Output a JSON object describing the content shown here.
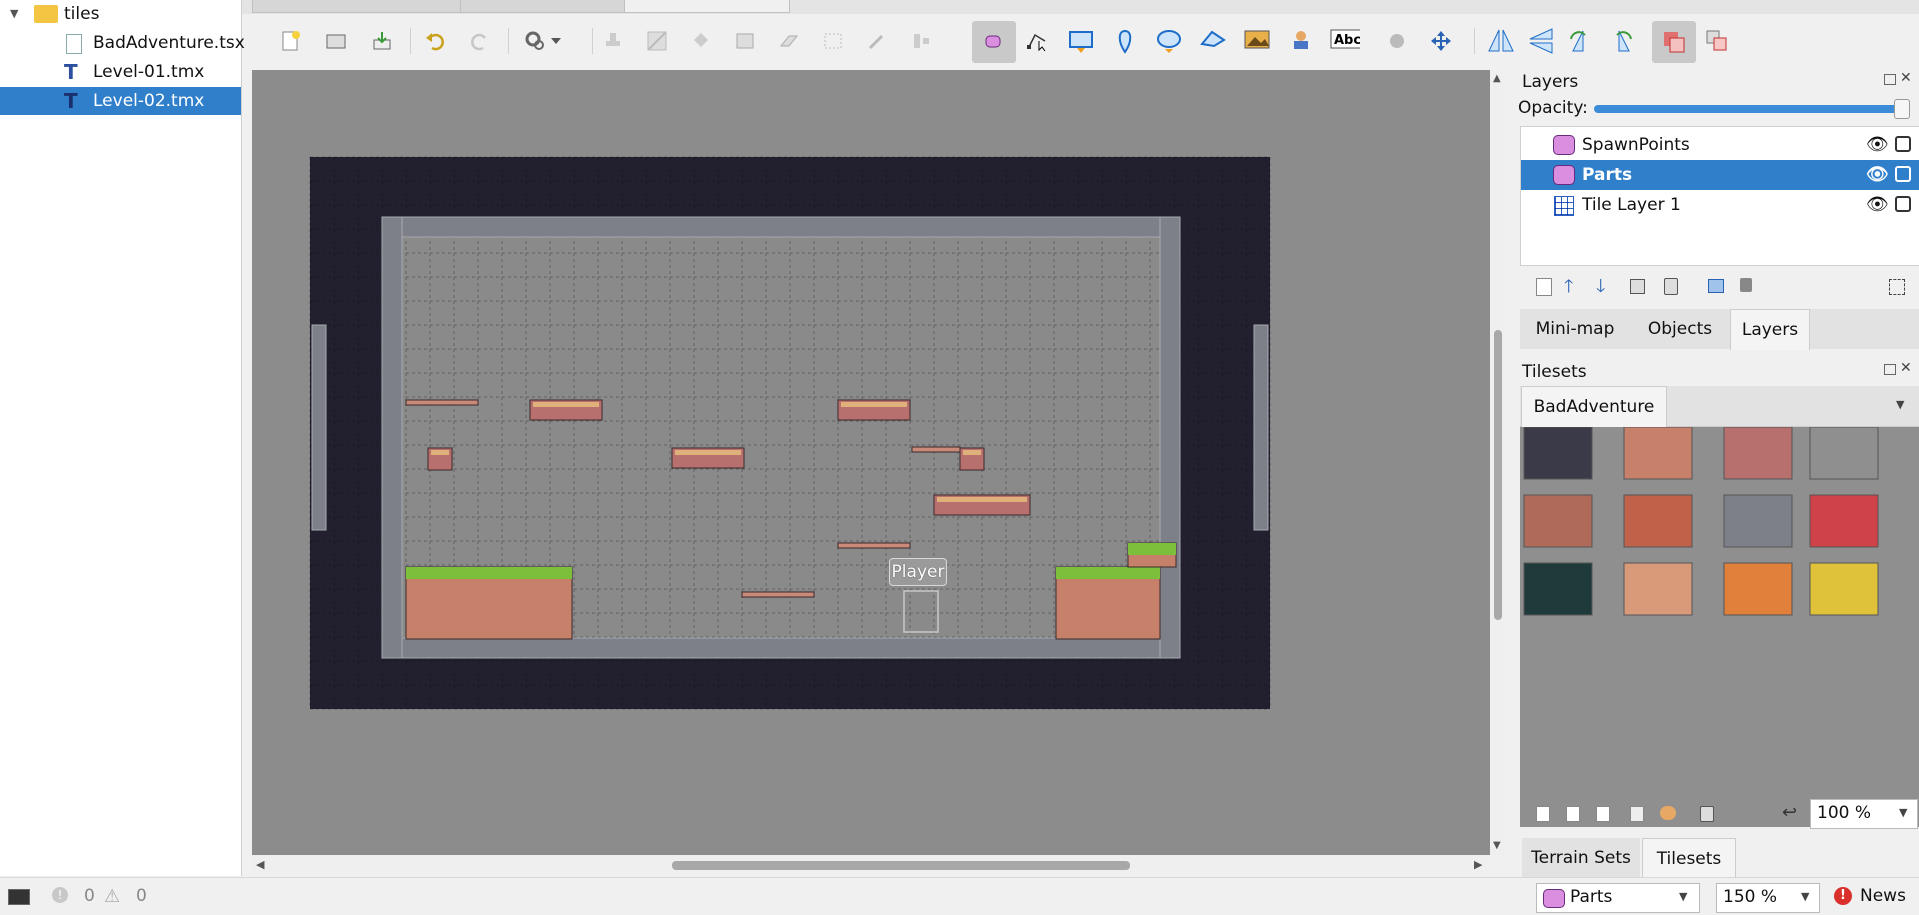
{
  "project": {
    "folder": "tiles",
    "files": [
      "BadAdventure.tsx",
      "Level-01.tmx",
      "Level-02.tmx"
    ]
  },
  "map": {
    "object_label": "Player"
  },
  "layers_panel": {
    "title": "Layers",
    "opacity_label": "Opacity:",
    "layers": [
      "SpawnPoints",
      "Parts",
      "Tile Layer 1"
    ],
    "tabs": [
      "Mini-map",
      "Objects",
      "Layers"
    ]
  },
  "tilesets_panel": {
    "title": "Tilesets",
    "tileset_tab": "BadAdventure",
    "zoom": "100 %",
    "tabs": [
      "Terrain Sets",
      "Tilesets"
    ]
  },
  "status": {
    "errors": "0",
    "warnings": "0",
    "layer_select": "Parts",
    "zoom": "150 %",
    "news": "News"
  },
  "colors": {
    "selection": "#2f7fcb",
    "canvas": "#8c8c8c",
    "map_bg": "#22202e"
  }
}
